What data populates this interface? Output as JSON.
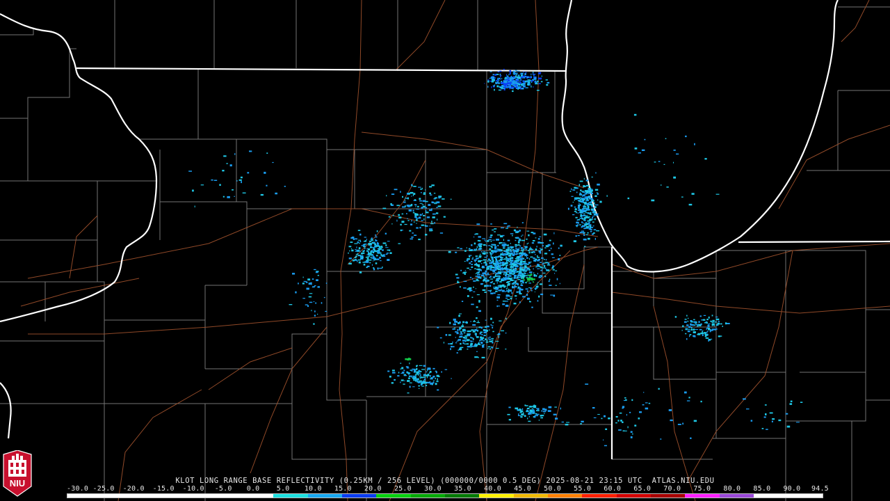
{
  "product_title": "KLOT LONG RANGE BASE REFLECTIVITY (0.25KM / 256 LEVEL) (000000/0000 0.5 DEG) 2025-08-21 23:15 UTC  ATLAS.NIU.EDU",
  "color_scale": {
    "tick_labels": [
      "-30.0",
      "-25.0",
      "-20.0",
      "-15.0",
      "-10.0",
      "-5.0",
      "0.0",
      "5.0",
      "10.0",
      "15.0",
      "20.0",
      "25.0",
      "30.0",
      "35.0",
      "40.0",
      "45.0",
      "50.0",
      "55.0",
      "60.0",
      "65.0",
      "70.0",
      "75.0",
      "80.0",
      "85.0",
      "90.0",
      "94.5"
    ],
    "segment_colors": [
      "#ffffff",
      "#ffffff",
      "#ffffff",
      "#ffffff",
      "#ffffff",
      "#ffffff",
      "#1de0e0",
      "#18a8f0",
      "#0a3cf0",
      "#08d010",
      "#06a808",
      "#047a05",
      "#fff000",
      "#f0b800",
      "#ff8000",
      "#ff2000",
      "#d40000",
      "#a80000",
      "#ff20ff",
      "#9a48d8",
      "#ffffff",
      "#ffffff"
    ]
  },
  "echo_colors": [
    "#1ec8e6",
    "#1a9cf0",
    "#0a40f5",
    "#12c848"
  ],
  "logo": {
    "text": "NIU",
    "icon": "niu-seal-icon"
  }
}
